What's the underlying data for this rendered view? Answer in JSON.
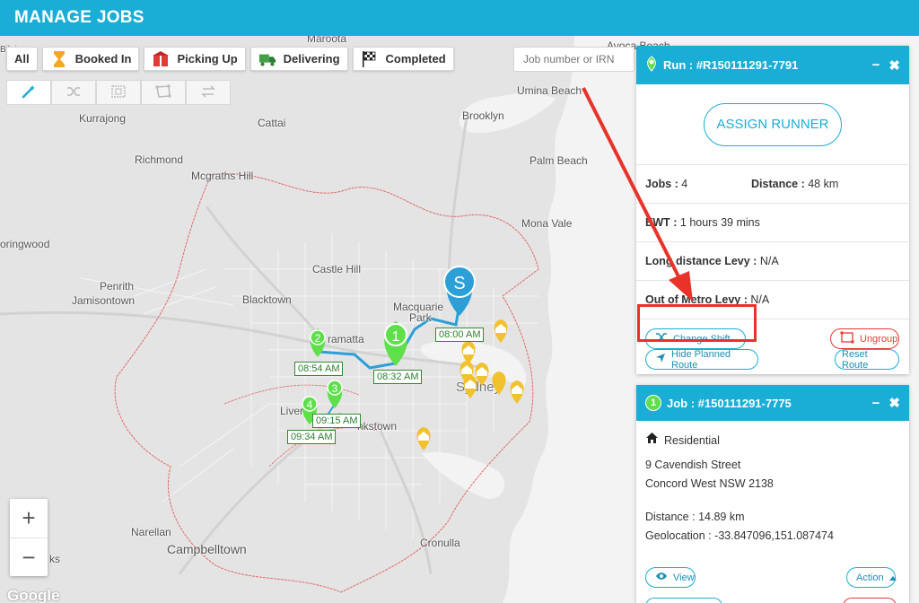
{
  "app": {
    "title": "MANAGE JOBS"
  },
  "filters": [
    {
      "label": "All",
      "icon": ""
    },
    {
      "label": "Booked In",
      "icon": "hourglass-icon"
    },
    {
      "label": "Picking Up",
      "icon": "package-icon"
    },
    {
      "label": "Delivering",
      "icon": "truck-icon"
    },
    {
      "label": "Completed",
      "icon": "checkered-flag-icon"
    }
  ],
  "tools": [
    "magic-wand-icon",
    "shuffle-icon",
    "select-box-icon",
    "polygon-select-icon",
    "swap-arrows-icon"
  ],
  "search": {
    "placeholder": "Job number or IRN"
  },
  "map": {
    "labels": [
      "Maroota",
      "Kurrajong",
      "Cattai",
      "Brooklyn",
      "Umina Beach",
      "Avoca Beach",
      "Richmond",
      "Mcgraths Hill",
      "Palm Beach",
      "Mona Vale",
      "oringwood",
      "Castle Hill",
      "Penrith",
      "Jamisontown",
      "Blacktown",
      "Macquarie",
      "Park",
      "ramatta",
      "Sydney",
      "Liverp",
      "nkstown",
      "Narellan",
      "Campbelltown",
      "Cronulla",
      "ks",
      "Bilpin"
    ],
    "google": "Google",
    "route_times": [
      "08:00 AM",
      "08:32 AM",
      "08:54 AM",
      "09:15 AM",
      "09:34 AM"
    ],
    "marker_numbers": [
      "1",
      "2",
      "3",
      "4"
    ],
    "start_marker": "S",
    "colors": {
      "route": "#2c9fd6",
      "job_marker": "#5fe04a",
      "pending_marker": "#f2c12e",
      "boundary": "#e36a6a",
      "water": "#f3f3f3",
      "land": "#e4e4e4"
    }
  },
  "zoom": {
    "in": "+",
    "out": "−"
  },
  "run_panel": {
    "title": "Run : #R150111291-7791",
    "minimize": "−",
    "close": "✖",
    "assign_runner": "ASSIGN RUNNER",
    "jobs_label": "Jobs :",
    "jobs_value": "4",
    "distance_label": "Distance :",
    "distance_value": "48 km",
    "ewt_label": "EWT :",
    "ewt_value": "1 hours 39 mins",
    "long_levy_label": "Long distance Levy :",
    "long_levy_value": "N/A",
    "metro_levy_label": "Out of Metro Levy :",
    "metro_levy_value": "N/A",
    "change_shift": "Change Shift",
    "ungroup": "Ungroup",
    "hide_route": "Hide Planned Route",
    "reset_route": "Reset Route"
  },
  "job_panel": {
    "number": "1",
    "title": "Job : #150111291-7775",
    "minimize": "−",
    "close": "✖",
    "type": "Residential",
    "address1": "9 Cavendish Street",
    "address2": "Concord West NSW 2138",
    "distance_label": "Distance :",
    "distance_value": "14.89 km",
    "geo_label": "Geolocation :",
    "geo_value": "-33.847096,151.087474",
    "view": "View",
    "action": "Action"
  },
  "annotation": {
    "color": "#e8322a"
  }
}
